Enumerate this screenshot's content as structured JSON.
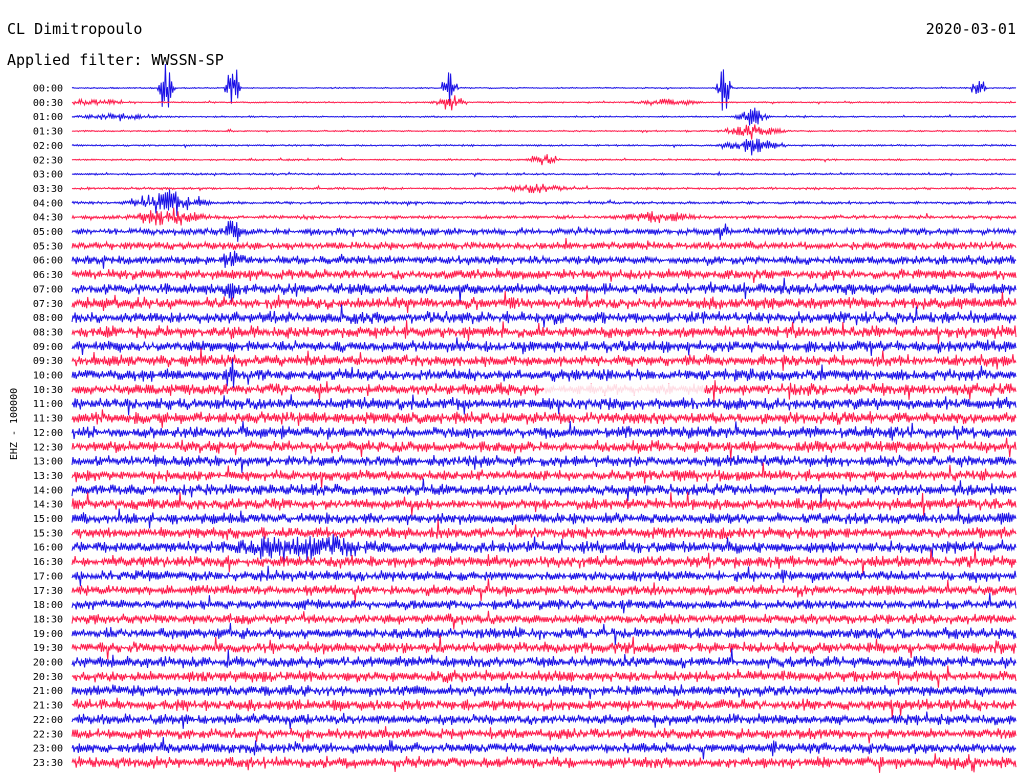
{
  "header": {
    "station": "CL Dimitropoulo",
    "date": "2020-03-01",
    "filter_label": "Applied filter:",
    "filter_value": "WWSSN-SP"
  },
  "colors": {
    "blue": "#1a10e6",
    "red": "#ff1a4a",
    "white": "#ffffff",
    "text": "#000000"
  },
  "chart_data": {
    "type": "line",
    "title": "",
    "ylabel": "EHZ - 100000",
    "xlabel": "",
    "grid": false,
    "legend": "none",
    "row_interval_minutes": 30,
    "row_labels": [
      "00:00",
      "00:30",
      "01:00",
      "01:30",
      "02:00",
      "02:30",
      "03:00",
      "03:30",
      "04:00",
      "04:30",
      "05:00",
      "05:30",
      "06:00",
      "06:30",
      "07:00",
      "07:30",
      "08:00",
      "08:30",
      "09:00",
      "09:30",
      "10:00",
      "10:30",
      "11:00",
      "11:30",
      "12:00",
      "12:30",
      "13:00",
      "13:30",
      "14:00",
      "14:30",
      "15:00",
      "15:30",
      "16:00",
      "16:30",
      "17:00",
      "17:30",
      "18:00",
      "18:30",
      "19:00",
      "19:30",
      "20:00",
      "20:30",
      "21:00",
      "21:30",
      "22:00",
      "22:30",
      "23:00",
      "23:30"
    ],
    "row_color_cycle": [
      "blue",
      "red"
    ],
    "noise_level_by_row": [
      0.1,
      0.12,
      0.12,
      0.12,
      0.14,
      0.14,
      0.16,
      0.18,
      0.22,
      0.28,
      0.55,
      0.65,
      0.75,
      0.85,
      0.95,
      1.0,
      1.0,
      1.0,
      1.0,
      1.0,
      1.0,
      1.0,
      1.0,
      1.0,
      1.0,
      1.0,
      0.95,
      0.95,
      0.95,
      0.95,
      0.95,
      0.95,
      1.0,
      1.0,
      0.9,
      0.85,
      0.85,
      0.85,
      0.9,
      0.95,
      0.95,
      0.95,
      0.95,
      0.95,
      0.9,
      0.9,
      0.9,
      0.95
    ],
    "events": [
      {
        "row": 0,
        "x": 0.1,
        "amplitude": 8.0,
        "duration": 0.01
      },
      {
        "row": 0,
        "x": 0.17,
        "amplitude": 6.0,
        "duration": 0.01
      },
      {
        "row": 0,
        "x": 0.4,
        "amplitude": 5.0,
        "duration": 0.01
      },
      {
        "row": 0,
        "x": 0.69,
        "amplitude": 6.5,
        "duration": 0.01
      },
      {
        "row": 0,
        "x": 0.96,
        "amplitude": 2.0,
        "duration": 0.01
      },
      {
        "row": 1,
        "x": 0.02,
        "amplitude": 0.6,
        "duration": 0.05
      },
      {
        "row": 1,
        "x": 0.4,
        "amplitude": 1.5,
        "duration": 0.02
      },
      {
        "row": 1,
        "x": 0.63,
        "amplitude": 0.7,
        "duration": 0.04
      },
      {
        "row": 2,
        "x": 0.05,
        "amplitude": 0.6,
        "duration": 0.05
      },
      {
        "row": 2,
        "x": 0.72,
        "amplitude": 2.0,
        "duration": 0.02
      },
      {
        "row": 3,
        "x": 0.72,
        "amplitude": 1.5,
        "duration": 0.04
      },
      {
        "row": 4,
        "x": 0.72,
        "amplitude": 1.8,
        "duration": 0.04
      },
      {
        "row": 5,
        "x": 0.5,
        "amplitude": 1.2,
        "duration": 0.02
      },
      {
        "row": 7,
        "x": 0.49,
        "amplitude": 0.8,
        "duration": 0.04
      },
      {
        "row": 8,
        "x": 0.1,
        "amplitude": 2.5,
        "duration": 0.05
      },
      {
        "row": 9,
        "x": 0.1,
        "amplitude": 1.5,
        "duration": 0.05
      },
      {
        "row": 9,
        "x": 0.62,
        "amplitude": 1.0,
        "duration": 0.05
      },
      {
        "row": 10,
        "x": 0.17,
        "amplitude": 2.5,
        "duration": 0.01
      },
      {
        "row": 10,
        "x": 0.69,
        "amplitude": 2.0,
        "duration": 0.01
      },
      {
        "row": 12,
        "x": 0.17,
        "amplitude": 3.0,
        "duration": 0.01
      },
      {
        "row": 14,
        "x": 0.17,
        "amplitude": 2.5,
        "duration": 0.01
      },
      {
        "row": 20,
        "x": 0.17,
        "amplitude": 2.0,
        "duration": 0.01
      },
      {
        "row": 32,
        "x": 0.25,
        "amplitude": 1.6,
        "duration": 0.1
      },
      {
        "row": 47,
        "x": 0.95,
        "amplitude": 1.6,
        "duration": 0.01
      }
    ],
    "gaps": [
      {
        "row": 21,
        "x_start": 0.5,
        "x_end": 0.67
      }
    ]
  }
}
